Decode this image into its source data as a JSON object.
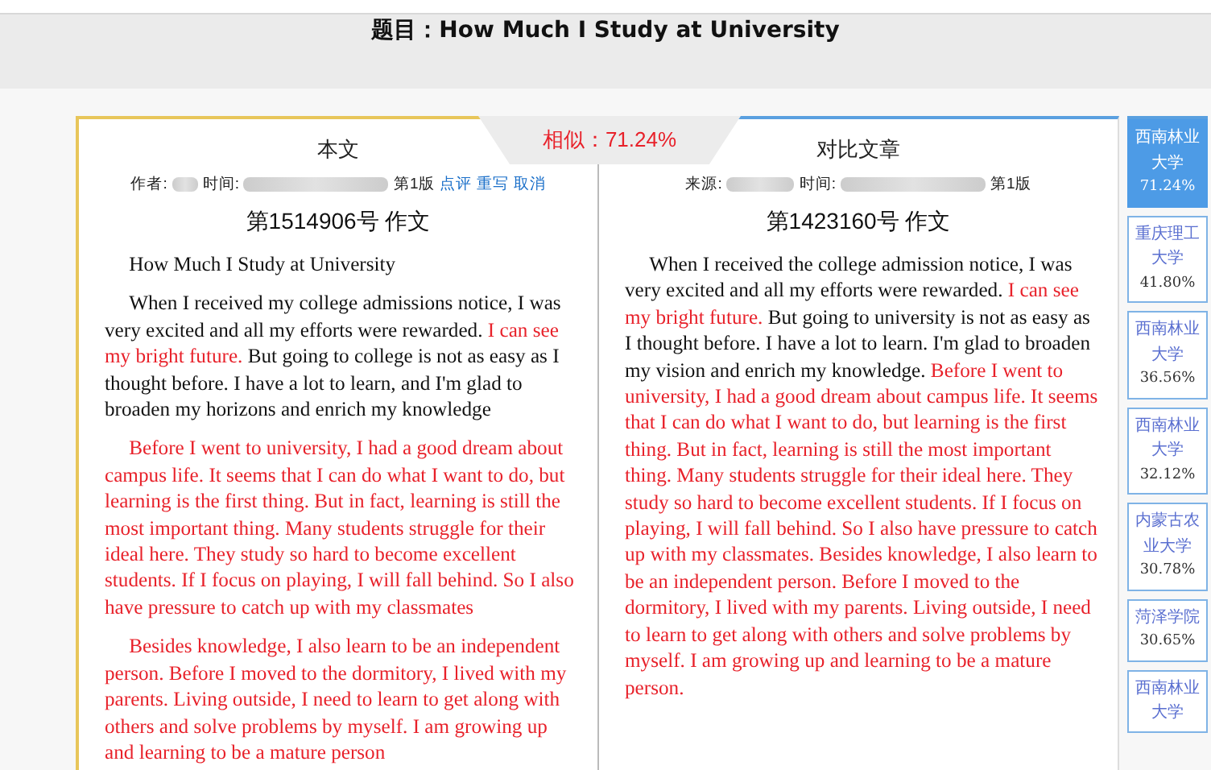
{
  "page_title": "题目：How Much I Study at University",
  "similarity": "相似：71.24%",
  "columns": [
    {
      "heading": "本文",
      "meta": [
        {
          "kind": "label",
          "text": "作者:"
        },
        {
          "kind": "redacted"
        },
        {
          "kind": "label",
          "text": "时间:"
        },
        {
          "kind": "redacted"
        },
        {
          "kind": "label",
          "text": "第1版"
        },
        {
          "kind": "link",
          "text": "点评"
        },
        {
          "kind": "link",
          "text": "重写"
        },
        {
          "kind": "link",
          "text": "取消"
        }
      ],
      "doc_title": "第1514906号 作文",
      "paragraphs": [
        [
          {
            "text": "How Much I Study at University",
            "highlighted": false
          }
        ],
        [
          {
            "text": "When I received my college admissions notice, I was very excited and all my efforts were rewarded. ",
            "highlighted": false
          },
          {
            "text": "I can see my bright future.",
            "highlighted": true
          },
          {
            "text": " But going to college is not as easy as I thought before. I have a lot to learn, and I'm glad to broaden my horizons and enrich my knowledge",
            "highlighted": false
          }
        ],
        [
          {
            "text": "Before I went to university, I had a good dream about campus life. It seems that I can do what I want to do, but learning is the first thing. But in fact, learning is still the most important thing. Many students struggle for their ideal here. They study so hard to become excellent students. If I focus on playing, I will fall behind. So I also have pressure to catch up with my classmates",
            "highlighted": true
          }
        ],
        [
          {
            "text": "Besides knowledge, I also learn to be an independent person. Before I moved to the dormitory, I lived with my parents. Living outside, I need to learn to get along with others and solve problems by myself. I am growing up and learning to be a mature person",
            "highlighted": true
          }
        ]
      ]
    },
    {
      "heading": "对比文章",
      "meta": [
        {
          "kind": "label",
          "text": "来源:"
        },
        {
          "kind": "redacted"
        },
        {
          "kind": "label",
          "text": "时间:"
        },
        {
          "kind": "redacted"
        },
        {
          "kind": "label",
          "text": "第1版"
        }
      ],
      "doc_title": "第1423160号 作文",
      "paragraphs": [
        [
          {
            "text": "When I received the college admission notice, I was very excited and all my efforts were rewarded. ",
            "highlighted": false
          },
          {
            "text": "I can see my bright future.",
            "highlighted": true
          },
          {
            "text": " But going to university is not as easy as I thought before. I have a lot to learn. I'm glad to broaden my vision and enrich my knowledge. ",
            "highlighted": false
          },
          {
            "text": "Before I went to university, I had a good dream about campus life. It seems that I can do what I want to do, but learning is the first thing. But in fact, learning is still the most important thing. Many students struggle for their ideal here. They study so hard to become excellent students. If I focus on playing, I will fall behind. So I also have pressure to catch up with my classmates. Besides knowledge, I also learn to be an independent person. Before I moved to the dormitory, I lived with my parents. Living outside, I need to learn to get along with others and solve problems by myself. I am growing up and learning to be a mature person.",
            "highlighted": true
          }
        ]
      ]
    }
  ],
  "matches": [
    {
      "name": "西南林业大学",
      "percent": "71.24%",
      "selected": true
    },
    {
      "name": "重庆理工大学",
      "percent": "41.80%",
      "selected": false
    },
    {
      "name": "西南林业大学",
      "percent": "36.56%",
      "selected": false
    },
    {
      "name": "西南林业大学",
      "percent": "32.12%",
      "selected": false
    },
    {
      "name": "内蒙古农业大学",
      "percent": "30.78%",
      "selected": false
    },
    {
      "name": "菏泽学院",
      "percent": "30.65%",
      "selected": false
    },
    {
      "name": "西南林业大学",
      "selected": false
    }
  ]
}
